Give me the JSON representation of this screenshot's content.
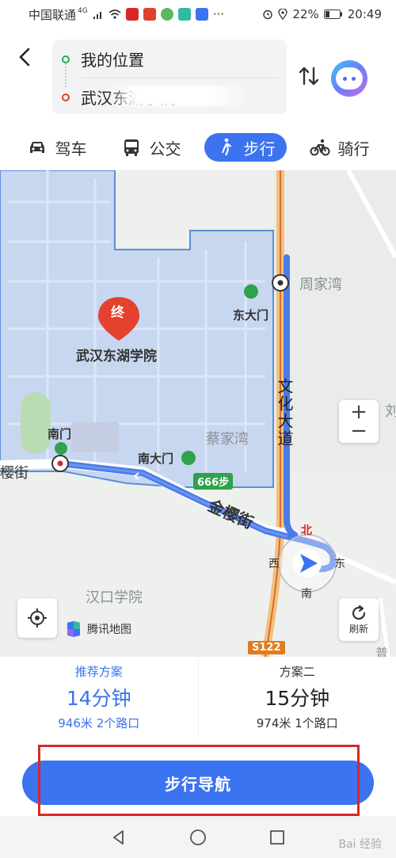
{
  "status_bar": {
    "carrier": "中国联通",
    "network": "4G",
    "battery": "22%",
    "time": "20:49"
  },
  "route": {
    "start": "我的位置",
    "end": "武汉东湖学院"
  },
  "tabs": [
    {
      "label": "驾车",
      "icon": "car-icon"
    },
    {
      "label": "公交",
      "icon": "bus-icon"
    },
    {
      "label": "步行",
      "icon": "walk-icon",
      "active": true
    },
    {
      "label": "骑行",
      "icon": "bike-icon"
    }
  ],
  "map": {
    "end_marker": "终",
    "destination_name": "武汉东湖学院",
    "labels": {
      "zhoujiawan": "周家湾",
      "east_gate": "东大门",
      "caijiawan": "蔡家湾",
      "south_gate_big": "南大门",
      "south_gate": "南门",
      "yinglingjie_left": "樱街",
      "jinyingjie": "金樱街",
      "wenhua_dadao": "文化大道",
      "hankou_college": "汉口学院",
      "compass_north": "北",
      "compass_west": "西",
      "compass_east": "东",
      "compass_south": "南",
      "edge_right": "刘",
      "edge_right_bottom": "普"
    },
    "steps_badge": "666步",
    "road_sign": "S122",
    "provider": "腾讯地图",
    "refresh_label": "刷新",
    "zoom_in": "+",
    "zoom_out": "−"
  },
  "plans": [
    {
      "tag": "推荐方案",
      "time": "14分钟",
      "distance": "946米",
      "crossings": "2个路口",
      "recommended": true
    },
    {
      "tag": "方案二",
      "time": "15分钟",
      "distance": "974米",
      "crossings": "1个路口",
      "recommended": false
    }
  ],
  "navigation_button": "步行导航",
  "watermark": "Bai 经验",
  "colors": {
    "accent": "#3b73f0",
    "campus_fill": "#c7d7f0",
    "route": "#4b7be8",
    "highlight": "#d8272b"
  }
}
